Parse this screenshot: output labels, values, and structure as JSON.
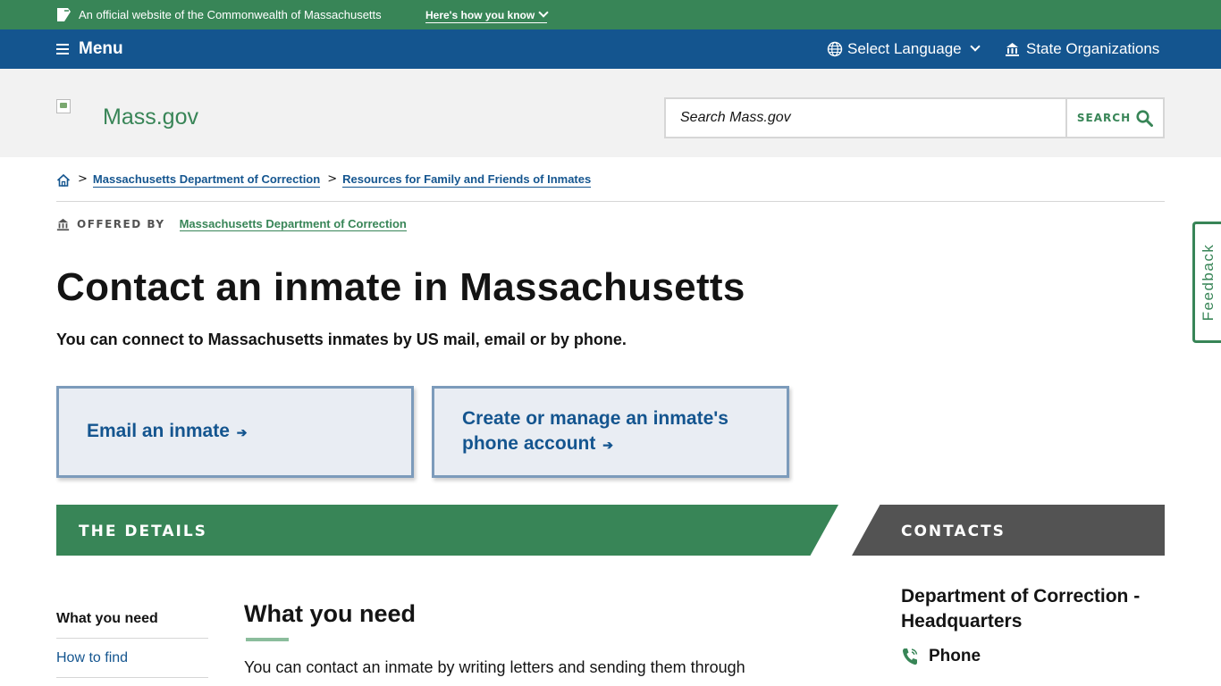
{
  "official_bar": {
    "text": "An official website of the Commonwealth of Massachusetts",
    "how_you_know": "Here's how you know"
  },
  "nav": {
    "menu_label": "Menu",
    "language_label": "Select Language",
    "orgs_label": "State Organizations"
  },
  "header": {
    "site_name": "Mass.gov",
    "search_placeholder": "Search Mass.gov",
    "search_button": "SEARCH"
  },
  "breadcrumb": {
    "items": [
      "Massachusetts Department of Correction",
      "Resources for Family and Friends of Inmates"
    ]
  },
  "offered_by": {
    "label": "OFFERED BY",
    "org": "Massachusetts Department of Correction"
  },
  "page": {
    "title": "Contact an inmate in Massachusetts",
    "lede": "You can connect to Massachusetts inmates by US mail, email or by phone."
  },
  "cards": [
    {
      "label": "Email an inmate"
    },
    {
      "label": "Create or manage an inmate's phone account"
    }
  ],
  "sections": {
    "details": "THE DETAILS",
    "contacts": "CONTACTS"
  },
  "toc": [
    {
      "label": "What you need"
    },
    {
      "label": "How to find"
    }
  ],
  "content": {
    "title": "What you need",
    "body": "You can contact an inmate by writing letters and sending them through"
  },
  "contact": {
    "org_name": "Department of Correction - Headquarters",
    "phone_label": "Phone"
  },
  "feedback": "Feedback",
  "colors": {
    "green": "#388557",
    "blue": "#14558f",
    "gray": "#535353",
    "card_bg": "#e9edf3"
  },
  "icons": [
    "seal-icon",
    "chevron-down-icon",
    "hamburger-icon",
    "globe-icon",
    "building-icon",
    "search-icon",
    "home-icon",
    "arrow-right-icon",
    "phone-icon"
  ]
}
